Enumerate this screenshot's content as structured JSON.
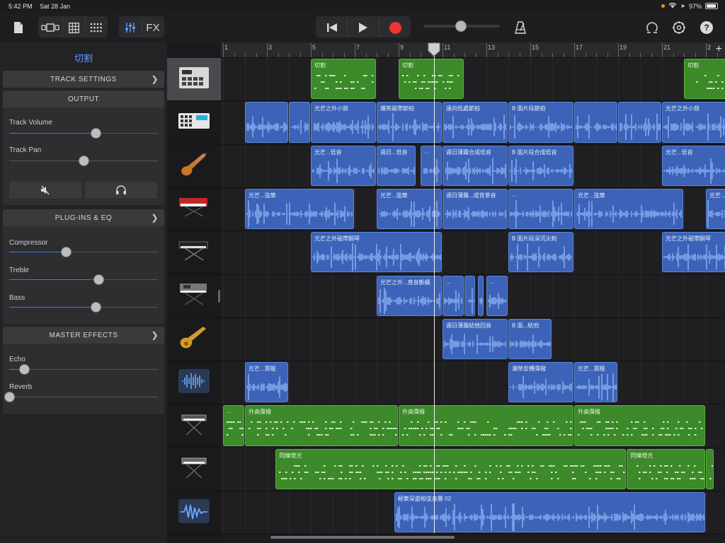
{
  "status": {
    "time": "5:42 PM",
    "date": "Sat 28 Jan",
    "battery": "97%"
  },
  "toolbar": {
    "fx_label": "FX",
    "icons": [
      "document-icon",
      "view-toggle-icon",
      "grid-icon",
      "dots-grid-icon",
      "mixer-icon",
      "rewind-icon",
      "play-icon",
      "record-icon",
      "metronome-icon",
      "loop-icon",
      "settings-icon",
      "help-icon"
    ],
    "master_volume": 0.49,
    "help_label": "?"
  },
  "inspector": {
    "title": "切割",
    "track_settings": "TRACK SETTINGS",
    "output": "OUTPUT",
    "track_volume_label": "Track Volume",
    "track_volume": 0.58,
    "track_pan_label": "Track Pan",
    "track_pan": 0.5,
    "plugins": "PLUG-INS & EQ",
    "compressor_label": "Compressor",
    "compressor": 0.38,
    "treble_label": "Treble",
    "treble": 0.6,
    "bass_label": "Bass",
    "bass": 0.58,
    "master": "MASTER EFFECTS",
    "echo_label": "Echo",
    "echo": 0.1,
    "reverb_label": "Reverb",
    "reverb": 0.0
  },
  "ruler": {
    "bars": [
      "1",
      "3",
      "5",
      "7",
      "9",
      "11",
      "13",
      "15",
      "17",
      "19",
      "21",
      "2"
    ],
    "add_label": "+"
  },
  "tracks": [
    {
      "name": "drum-machine",
      "regions": [
        {
          "label": "切割",
          "start": 3,
          "len": 1.5,
          "color": "green",
          "kind": "dots"
        },
        {
          "label": "切割",
          "start": 5,
          "len": 1.5,
          "color": "green",
          "kind": "dots"
        },
        {
          "label": "切割",
          "start": 11.5,
          "len": 1.5,
          "color": "green",
          "kind": "dots"
        }
      ]
    },
    {
      "name": "beat-sequencer",
      "regions": [
        {
          "label": "",
          "start": 1.5,
          "len": 1,
          "color": "blue",
          "kind": "wave"
        },
        {
          "label": "",
          "start": 2.5,
          "len": 0.5,
          "color": "blue",
          "kind": "wave"
        },
        {
          "label": "光芒之外小鼓",
          "start": 3,
          "len": 1.5,
          "color": "blue",
          "kind": "wave"
        },
        {
          "label": "爆笑磁帶節拍",
          "start": 4.5,
          "len": 1.5,
          "color": "blue",
          "kind": "wave"
        },
        {
          "label": "遠向低處節拍",
          "start": 6,
          "len": 1.5,
          "color": "blue",
          "kind": "wave"
        },
        {
          "label": "B 面片段節拍",
          "start": 7.5,
          "len": 1.5,
          "color": "blue",
          "kind": "wave"
        },
        {
          "label": "",
          "start": 9,
          "len": 1,
          "color": "blue",
          "kind": "wave"
        },
        {
          "label": "",
          "start": 10,
          "len": 1,
          "color": "blue",
          "kind": "wave"
        },
        {
          "label": "光芒之外小鼓",
          "start": 11,
          "len": 1.5,
          "color": "blue",
          "kind": "wave"
        }
      ]
    },
    {
      "name": "bass-guitar",
      "regions": [
        {
          "label": "光芒...低音",
          "start": 3,
          "len": 1.5,
          "color": "blue",
          "kind": "wave"
        },
        {
          "label": "週日...低音",
          "start": 4.5,
          "len": 0.9,
          "color": "blue",
          "kind": "wave"
        },
        {
          "label": "...",
          "start": 5.5,
          "len": 0.5,
          "color": "blue",
          "kind": "wave"
        },
        {
          "label": "週日薄霧合成低音",
          "start": 6,
          "len": 1.5,
          "color": "blue",
          "kind": "wave"
        },
        {
          "label": "B 面片段合成低音",
          "start": 7.5,
          "len": 1.5,
          "color": "blue",
          "kind": "wave"
        },
        {
          "label": "光芒...低音",
          "start": 11,
          "len": 1.5,
          "color": "blue",
          "kind": "wave"
        }
      ]
    },
    {
      "name": "red-keyboard",
      "regions": [
        {
          "label": "光芒...弦樂",
          "start": 1.5,
          "len": 2.5,
          "color": "blue",
          "kind": "wave"
        },
        {
          "label": "光芒...弦樂",
          "start": 4.5,
          "len": 1.5,
          "color": "blue",
          "kind": "wave"
        },
        {
          "label": "週日薄霧...成背景音",
          "start": 6,
          "len": 1.5,
          "color": "blue",
          "kind": "wave"
        },
        {
          "label": "...",
          "start": 7.5,
          "len": 1.5,
          "color": "blue",
          "kind": "wave"
        },
        {
          "label": "光芒...弦樂",
          "start": 9,
          "len": 2.5,
          "color": "blue",
          "kind": "wave"
        },
        {
          "label": "光芒...弦樂",
          "start": 12,
          "len": 1,
          "color": "blue",
          "kind": "wave"
        }
      ]
    },
    {
      "name": "black-keyboard",
      "regions": [
        {
          "label": "光芒之外磁帶鋼琴",
          "start": 3,
          "len": 3,
          "color": "blue",
          "kind": "wave"
        },
        {
          "label": "B 面片段深沉尖刺",
          "start": 7.5,
          "len": 1.5,
          "color": "blue",
          "kind": "wave"
        },
        {
          "label": "光芒之外磁帶鋼琴",
          "start": 11,
          "len": 1.5,
          "color": "blue",
          "kind": "wave"
        }
      ]
    },
    {
      "name": "synth-keyboard",
      "regions": [
        {
          "label": "光芒之外...竟音斷續",
          "start": 4.5,
          "len": 1.5,
          "color": "blue",
          "kind": "wave"
        },
        {
          "label": "...",
          "start": 6,
          "len": 0.5,
          "color": "blue",
          "kind": "wave"
        },
        {
          "label": "",
          "start": 6.5,
          "len": 0.25,
          "color": "blue",
          "kind": "wave"
        },
        {
          "label": "",
          "start": 6.8,
          "len": 0.15,
          "color": "blue",
          "kind": "wave"
        },
        {
          "label": "...",
          "start": 7,
          "len": 0.5,
          "color": "blue",
          "kind": "wave"
        }
      ]
    },
    {
      "name": "electric-guitar",
      "regions": [
        {
          "label": "週日薄霧結他回音",
          "start": 6,
          "len": 1.5,
          "color": "blue",
          "kind": "wave"
        },
        {
          "label": "B 面...結他",
          "start": 7.5,
          "len": 1,
          "color": "blue",
          "kind": "wave"
        }
      ]
    },
    {
      "name": "audio-recorder",
      "regions": [
        {
          "label": "光芒...貫眠",
          "start": 1.5,
          "len": 1,
          "color": "blue",
          "kind": "wave"
        },
        {
          "label": "瀬草反轉彈撥",
          "start": 7.5,
          "len": 1.5,
          "color": "blue",
          "kind": "wave"
        },
        {
          "label": "光芒...貫眠",
          "start": 9,
          "len": 1,
          "color": "blue",
          "kind": "wave"
        }
      ]
    },
    {
      "name": "keyboard-stand-a",
      "regions": [
        {
          "label": "...",
          "start": 1,
          "len": 0.5,
          "color": "green",
          "kind": "dots"
        },
        {
          "label": "升高彈撥",
          "start": 1.5,
          "len": 3.5,
          "color": "green",
          "kind": "dots"
        },
        {
          "label": "升高彈撥",
          "start": 5,
          "len": 4,
          "color": "green",
          "kind": "dots"
        },
        {
          "label": "升高彈撥",
          "start": 9,
          "len": 3,
          "color": "green",
          "kind": "dots"
        }
      ]
    },
    {
      "name": "keyboard-stand-b",
      "regions": [
        {
          "label": "閃爍燈光",
          "start": 2.2,
          "len": 8,
          "color": "green",
          "kind": "dots"
        },
        {
          "label": "閃爍燈光",
          "start": 10.2,
          "len": 1.8,
          "color": "green",
          "kind": "dots"
        },
        {
          "label": "",
          "start": 12,
          "len": 0.2,
          "color": "green",
          "kind": "dots"
        }
      ]
    },
    {
      "name": "audio-waveform",
      "regions": [
        {
          "label": "極樂深遊和弦音層 02",
          "start": 4.9,
          "len": 7.1,
          "color": "blue",
          "kind": "wave"
        }
      ]
    }
  ]
}
